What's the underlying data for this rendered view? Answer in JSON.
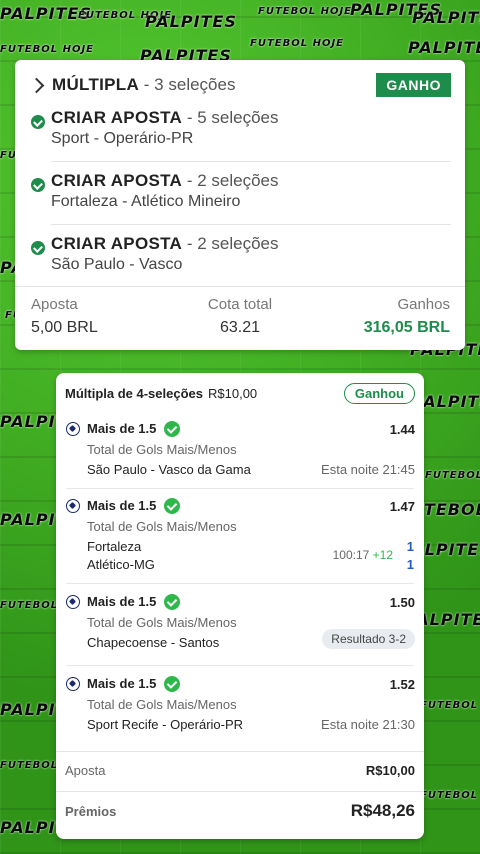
{
  "background_words": [
    "PALPITES",
    "FUTEBOL HOJE",
    "PALPITES",
    "FUTEBOL HOJE",
    "PALPITES",
    "PALPITES",
    "FUTEBOL HOJE",
    "PALPITES",
    "FUTEBOL HOJE",
    "PALPITES",
    "FUTEBOL HOJE",
    "PALPITES",
    "FUTEBOL HOJE",
    "PALPITES",
    "PALPITES",
    "FUTEBOL",
    "PALPITES",
    "FUTEBOL HOJE",
    "PALPITES",
    "PALPITES",
    "FUTEBOL HOJE",
    "PALPITES",
    "FUTEBOL HOJE",
    "PALPITES",
    "FUTEBOL HOJE",
    "PALPITES",
    "FUTEBOL HOJE"
  ],
  "card1": {
    "title_strong": "MÚLTIPLA",
    "title_rest": " - 3 seleções",
    "status": "GANHO",
    "selections": [
      {
        "market": "CRIAR APOSTA",
        "count": " - 5 seleções",
        "match": "Sport - Operário-PR"
      },
      {
        "market": "CRIAR APOSTA",
        "count": " - 2 seleções",
        "match": "Fortaleza - Atlético Mineiro"
      },
      {
        "market": "CRIAR APOSTA",
        "count": " - 2 seleções",
        "match": "São Paulo - Vasco"
      }
    ],
    "stake_label": "Aposta",
    "stake_value": "5,00 BRL",
    "odds_label": "Cota total",
    "odds_value": "63.21",
    "winnings_label": "Ganhos",
    "winnings_value": "316,05 BRL"
  },
  "card2": {
    "title_strong": "Múltipla de 4-seleções",
    "title_amount": "R$10,00",
    "status": "Ganhou",
    "bets": [
      {
        "pick": "Mais de 1.5",
        "odd": "1.44",
        "market": "Total de Gols Mais/Menos",
        "teams": "São Paulo - Vasco da Gama",
        "time": "Esta noite 21:45"
      },
      {
        "pick": "Mais de 1.5",
        "odd": "1.47",
        "market": "Total de Gols Mais/Menos",
        "team_home": "Fortaleza",
        "team_away": "Atlético-MG",
        "clock": "100:17",
        "added": "+12",
        "score_home": "1",
        "score_away": "1"
      },
      {
        "pick": "Mais de 1.5",
        "odd": "1.50",
        "market": "Total de Gols Mais/Menos",
        "teams": "Chapecoense - Santos",
        "result": "Resultado 3-2"
      },
      {
        "pick": "Mais de 1.5",
        "odd": "1.52",
        "market": "Total de Gols Mais/Menos",
        "teams": "Sport Recife - Operário-PR",
        "time": "Esta noite 21:30"
      }
    ],
    "stake_label": "Aposta",
    "stake_value": "R$10,00",
    "prize_label": "Prêmios",
    "prize_value": "R$48,26"
  },
  "colors": {
    "win_green": "#1e8c4a",
    "check_green": "#2eb84c",
    "score_blue": "#1f5fc2",
    "field_green": "#3aa91f"
  },
  "icons": [
    "chevron-right-icon",
    "check-circle-icon",
    "soccer-ball-icon"
  ]
}
